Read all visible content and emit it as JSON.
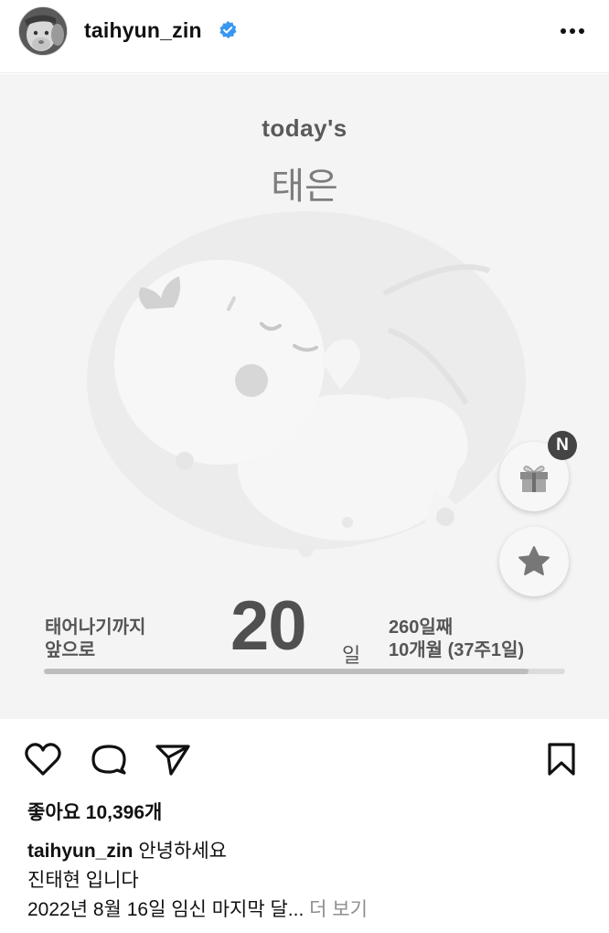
{
  "header": {
    "username": "taihyun_zin",
    "verified_icon": "verified-badge-icon",
    "more_icon": "more-options-icon"
  },
  "post_image": {
    "heading": "today's",
    "name": "태은",
    "illustration": "fetus-illustration",
    "gift_badge": "N",
    "until_line1": "태어나기까지",
    "until_line2": "앞으로",
    "days_left": "20",
    "days_unit": "일",
    "day_count": "260일째",
    "month_week": "10개월 (37주1일)",
    "progress_fraction": 0.93,
    "colors": {
      "accent": "#505050",
      "background": "#f4f4f4"
    }
  },
  "actions": {
    "like_icon": "heart-icon",
    "comment_icon": "comment-icon",
    "share_icon": "send-icon",
    "save_icon": "bookmark-icon"
  },
  "likes": "좋아요 10,396개",
  "caption": {
    "username": "taihyun_zin",
    "line1": "안녕하세요",
    "line2": "진태현 입니다",
    "line3": "2022년 8월 16일 임신 마지막 달...",
    "more_label": "더 보기"
  }
}
